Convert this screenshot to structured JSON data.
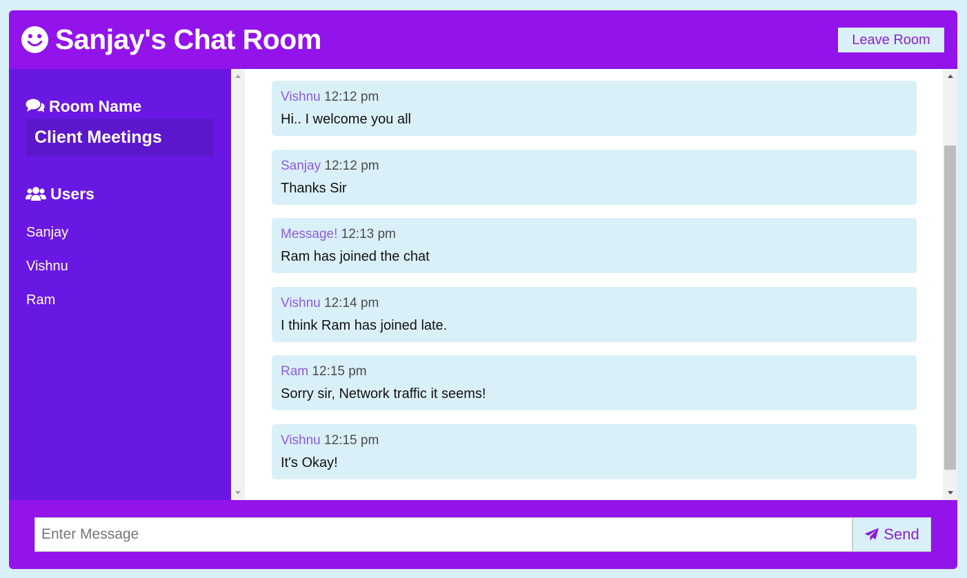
{
  "header": {
    "title": "Sanjay's Chat Room",
    "leave_label": "Leave Room",
    "logo_icon": "smile-icon"
  },
  "sidebar": {
    "room_heading": "Room Name",
    "room_heading_icon": "comments-icon",
    "room_name": "Client Meetings",
    "users_heading": "Users",
    "users_heading_icon": "users-icon",
    "users": [
      "Sanjay",
      "Vishnu",
      "Ram"
    ]
  },
  "messages": [
    {
      "author": "Vishnu",
      "time": "12:12 pm",
      "text": "Hi.. I welcome you all"
    },
    {
      "author": "Sanjay",
      "time": "12:12 pm",
      "text": "Thanks Sir"
    },
    {
      "author": "Message!",
      "time": "12:13 pm",
      "text": "Ram has joined the chat"
    },
    {
      "author": "Vishnu",
      "time": "12:14 pm",
      "text": "I think Ram has joined late."
    },
    {
      "author": "Ram",
      "time": "12:15 pm",
      "text": "Sorry sir, Network traffic it seems!"
    },
    {
      "author": "Vishnu",
      "time": "12:15 pm",
      "text": "It's Okay!"
    }
  ],
  "form": {
    "placeholder": "Enter Message",
    "value": "",
    "send_label": "Send",
    "send_icon": "paper-plane-icon"
  },
  "colors": {
    "header_bg": "#9314ea",
    "sidebar_bg": "#6918e3",
    "room_box_bg": "#5c17cc",
    "message_bg": "#daf0f8",
    "author_color": "#8d5be0",
    "page_bg": "#daf0f8"
  }
}
